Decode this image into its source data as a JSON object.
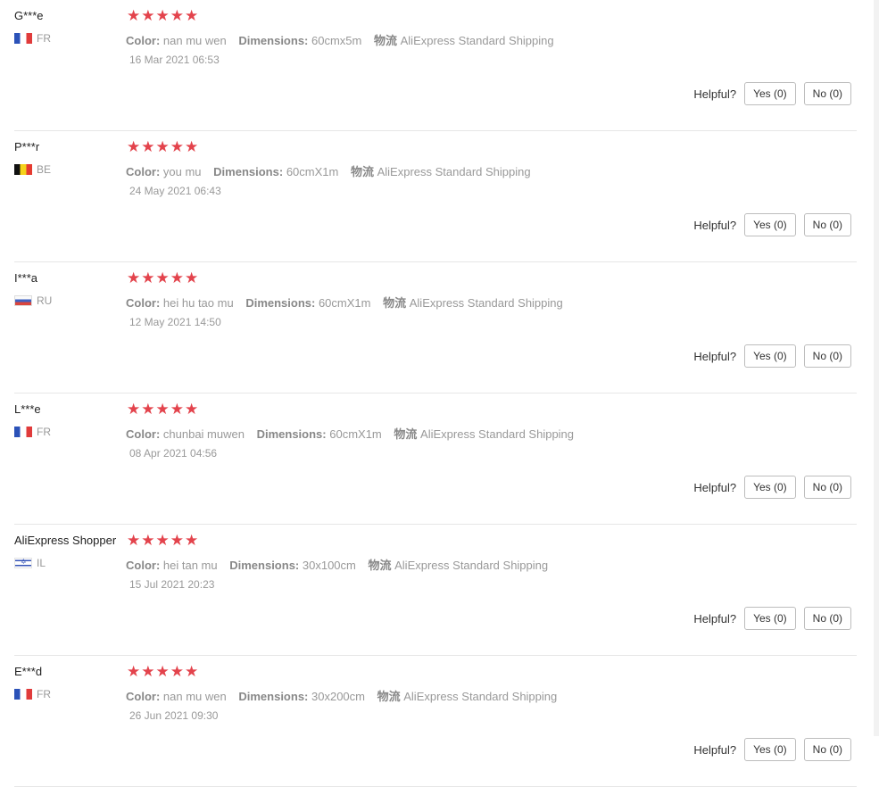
{
  "reviews": [
    {
      "user": "G***e",
      "flag": "fr",
      "country": "FR",
      "rating": 5,
      "color_label": "Color:",
      "color": "nan mu wen",
      "dimensions_label": "Dimensions:",
      "dimensions": "60cmx5m",
      "logistics_label": "物流",
      "logistics": "AliExpress Standard Shipping",
      "date": "16 Mar 2021 06:53",
      "helpful_label": "Helpful?",
      "yes": "Yes (0)",
      "no": "No (0)"
    },
    {
      "user": "P***r",
      "flag": "be",
      "country": "BE",
      "rating": 5,
      "color_label": "Color:",
      "color": "you mu",
      "dimensions_label": "Dimensions:",
      "dimensions": "60cmX1m",
      "logistics_label": "物流",
      "logistics": "AliExpress Standard Shipping",
      "date": "24 May 2021 06:43",
      "helpful_label": "Helpful?",
      "yes": "Yes (0)",
      "no": "No (0)"
    },
    {
      "user": "I***a",
      "flag": "ru",
      "country": "RU",
      "rating": 5,
      "color_label": "Color:",
      "color": "hei hu tao mu",
      "dimensions_label": "Dimensions:",
      "dimensions": "60cmX1m",
      "logistics_label": "物流",
      "logistics": "AliExpress Standard Shipping",
      "date": "12 May 2021 14:50",
      "helpful_label": "Helpful?",
      "yes": "Yes (0)",
      "no": "No (0)"
    },
    {
      "user": "L***e",
      "flag": "fr",
      "country": "FR",
      "rating": 5,
      "color_label": "Color:",
      "color": "chunbai muwen",
      "dimensions_label": "Dimensions:",
      "dimensions": "60cmX1m",
      "logistics_label": "物流",
      "logistics": "AliExpress Standard Shipping",
      "date": "08 Apr 2021 04:56",
      "helpful_label": "Helpful?",
      "yes": "Yes (0)",
      "no": "No (0)"
    },
    {
      "user": "AliExpress Shopper",
      "flag": "il",
      "country": "IL",
      "rating": 5,
      "color_label": "Color:",
      "color": "hei tan mu",
      "dimensions_label": "Dimensions:",
      "dimensions": "30x100cm",
      "logistics_label": "物流",
      "logistics": "AliExpress Standard Shipping",
      "date": "15 Jul 2021 20:23",
      "helpful_label": "Helpful?",
      "yes": "Yes (0)",
      "no": "No (0)"
    },
    {
      "user": "E***d",
      "flag": "fr",
      "country": "FR",
      "rating": 5,
      "color_label": "Color:",
      "color": "nan mu wen",
      "dimensions_label": "Dimensions:",
      "dimensions": "30x200cm",
      "logistics_label": "物流",
      "logistics": "AliExpress Standard Shipping",
      "date": "26 Jun 2021 09:30",
      "helpful_label": "Helpful?",
      "yes": "Yes (0)",
      "no": "No (0)"
    }
  ],
  "star_icon": "star-icon",
  "star_color": "#e3434c"
}
